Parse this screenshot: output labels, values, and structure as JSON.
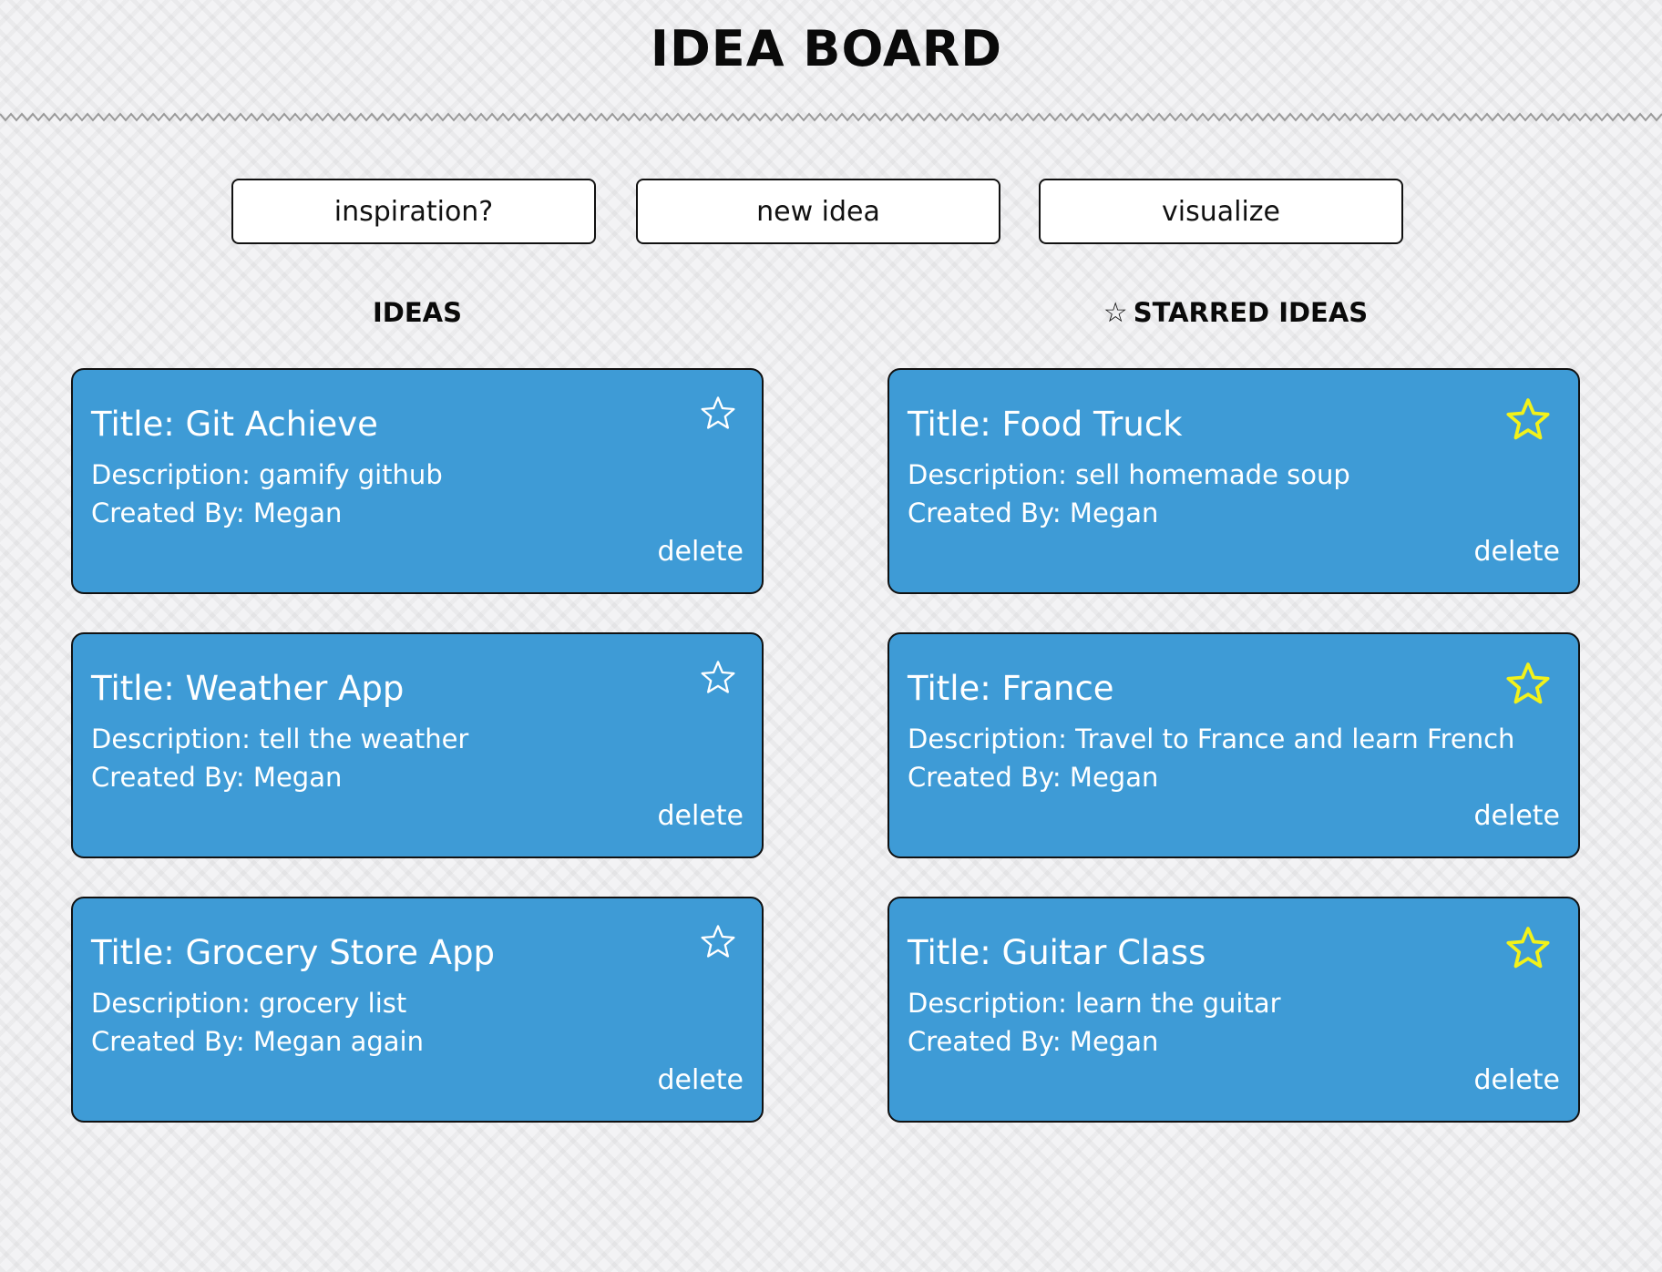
{
  "header": {
    "title": "IDEA BOARD"
  },
  "toolbar": {
    "buttons": [
      {
        "label": "inspiration?"
      },
      {
        "label": "new idea"
      },
      {
        "label": "visualize"
      }
    ]
  },
  "columns": {
    "ideas": {
      "heading": "IDEAS"
    },
    "starred": {
      "heading_icon": "☆",
      "heading": "STARRED IDEAS"
    }
  },
  "ideas": [
    {
      "title": "Title: Git Achieve",
      "description": "Description: gamify github",
      "created_by": "Created By: Megan",
      "delete_label": "delete",
      "starred": false
    },
    {
      "title": "Title: Weather App",
      "description": "Description: tell the weather",
      "created_by": "Created By: Megan",
      "delete_label": "delete",
      "starred": false
    },
    {
      "title": "Title: Grocery Store App",
      "description": "Description: grocery list",
      "created_by": "Created By: Megan again",
      "delete_label": "delete",
      "starred": false
    }
  ],
  "starred_ideas": [
    {
      "title": "Title: Food Truck",
      "description": "Description: sell homemade soup",
      "created_by": "Created By: Megan",
      "delete_label": "delete",
      "starred": true
    },
    {
      "title": "Title: France",
      "description": "Description: Travel to France and learn French",
      "created_by": "Created By: Megan",
      "delete_label": "delete",
      "starred": true
    },
    {
      "title": "Title: Guitar Class",
      "description": "Description: learn the guitar",
      "created_by": "Created By: Megan",
      "delete_label": "delete",
      "starred": true
    }
  ],
  "colors": {
    "card_background": "#3e9bd6",
    "card_border": "#111111",
    "star_unstarred": "#ffffff",
    "star_starred": "#f2f21a",
    "page_background": "#f3f3f5"
  }
}
